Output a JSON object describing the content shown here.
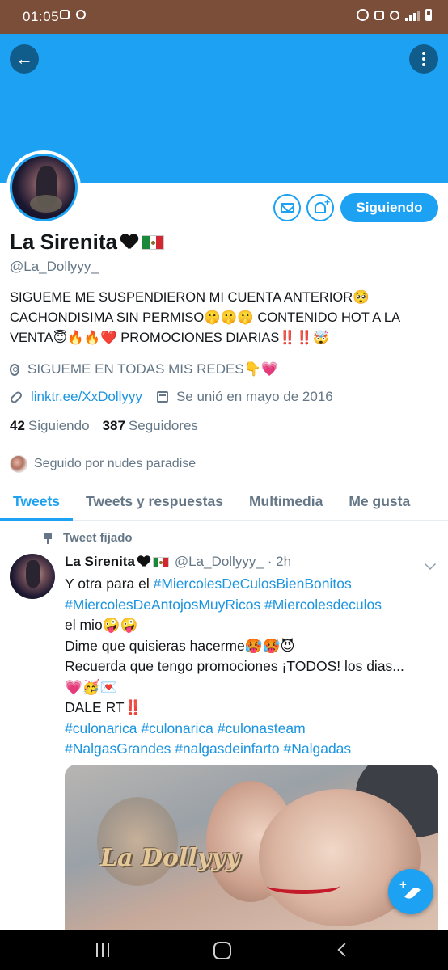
{
  "status_bar": {
    "time": "01:05"
  },
  "profile": {
    "display_name": "La Sirenita",
    "handle": "@La_Dollyyy_",
    "bio": "SIGUEME ME SUSPENDIERON MI CUENTA ANTERIOR🥺 CACHONDISIMA SIN PERMISO🤫🤫🤫 CONTENIDO HOT A LA VENTA😇🔥🔥❤️ PROMOCIONES DIARIAS‼️‼️🤯",
    "location": "SIGUEME EN TODAS MIS REDES👇💗",
    "website": "linktr.ee/XxDollyyy",
    "joined": "Se unió en mayo de 2016",
    "following_count": "42",
    "following_label": "Siguiendo",
    "followers_count": "387",
    "followers_label": "Seguidores",
    "followed_by": "Seguido por nudes paradise",
    "follow_button": "Siguiendo"
  },
  "tabs": [
    "Tweets",
    "Tweets y respuestas",
    "Multimedia",
    "Me gusta"
  ],
  "pinned_tweet": {
    "label": "Tweet fijado",
    "author_name": "La Sirenita",
    "author_handle": "@La_Dollyyy_",
    "time_meta": "· 2h",
    "lines": {
      "l1_text": "Y otra para el ",
      "l1_tag": "#MiercolesDeCulosBienBonitos",
      "l2_tag1": "#MiercolesDeAntojosMuyRicos",
      "l2_tag2": "#Miercolesdeculos",
      "l3": "el mio🤪🤪",
      "l4": "Dime que quisieras hacerme🥵🥵😈",
      "l5": "Recuerda que tengo promociones ¡TODOS! los dias...",
      "l6": "💗🥳💌",
      "l7": "DALE RT‼️",
      "l8_tag1": "#culonarica",
      "l8_tag2": "#culonarica",
      "l8_tag3": "#culonasteam",
      "l9_tag1": "#NalgasGrandes",
      "l9_tag2": "#nalgasdeinfarto",
      "l9_tag3": "#Nalgadas"
    },
    "image_watermark": "La Dollyyy"
  },
  "colors": {
    "accent": "#1da1f2",
    "status_bar": "#7b4e3a",
    "banner": "#1da1f2",
    "secondary_text": "#657786"
  },
  "icons": {
    "back": "arrow-left-icon",
    "more": "more-vertical-icon",
    "mail": "mail-icon",
    "notify": "bell-plus-icon",
    "location": "location-pin-icon",
    "link": "link-icon",
    "calendar": "calendar-icon",
    "pin": "pin-icon",
    "compose": "feather-compose-icon"
  }
}
